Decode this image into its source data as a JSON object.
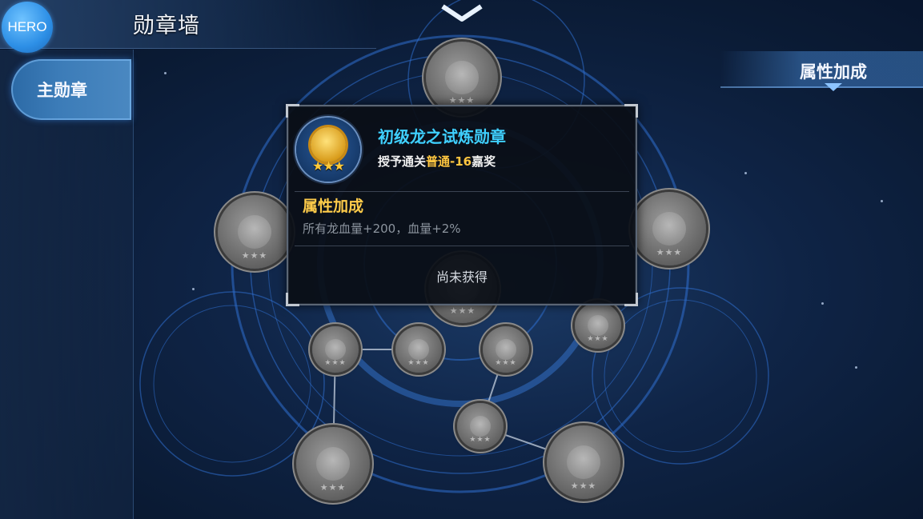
{
  "header": {
    "badge": "HERO",
    "title": "勋章墙"
  },
  "sidebar": {
    "tabs": [
      {
        "label": "主勋章",
        "active": true
      }
    ]
  },
  "right_panel": {
    "label": "属性加成"
  },
  "popup": {
    "medal_name": "初级龙之试炼勋章",
    "desc_prefix": "授予通关",
    "desc_highlight": "普通-16",
    "desc_suffix": "嘉奖",
    "stars": "★★★",
    "attr_title": "属性加成",
    "attr_value": "所有龙血量+200，血量+2%",
    "status": "尚未获得"
  },
  "medal_stars": "★★★",
  "colors": {
    "accent_blue": "#3fd0ff",
    "gold": "#ffcc4a",
    "background": "#0f2446"
  }
}
